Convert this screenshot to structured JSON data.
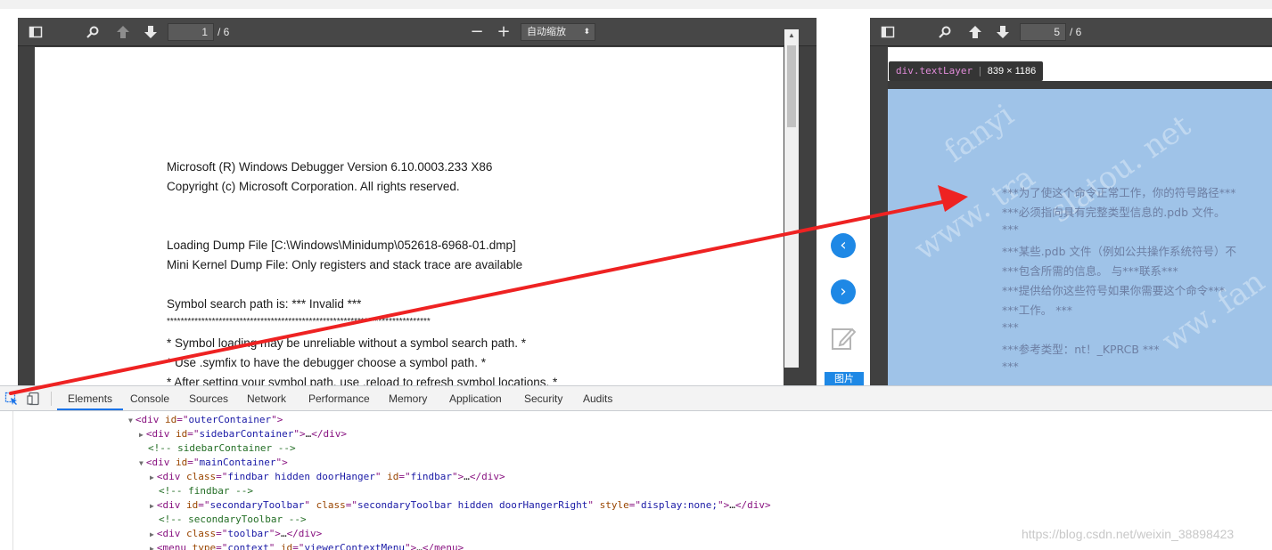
{
  "left_viewer": {
    "toolbar": {
      "sidebar_icon": "sidebar-toggle-icon",
      "search_icon": "search-icon",
      "prev_icon": "arrow-up-icon",
      "next_icon": "arrow-down-icon",
      "page_value": "1",
      "page_total": "/ 6",
      "zoom_out": "−",
      "zoom_in": "+",
      "zoom_select": "自动缩放",
      "zoom_arrow": "⬍"
    },
    "lines": [
      "Microsoft (R) Windows Debugger Version 6.10.0003.233 X86",
      "Copyright (c) Microsoft Corporation. All rights reserved.",
      "Loading Dump File [C:\\Windows\\Minidump\\052618-6968-01.dmp]",
      "Mini Kernel Dump File: Only registers and stack trace are available",
      "Symbol search path is: *** Invalid ***",
      "****************************************************************************",
      "* Symbol loading may be unreliable without a symbol search path.                  *",
      "* Use .symfix to have the debugger choose a symbol path.                          *",
      "* After setting your symbol path, use .reload to refresh symbol locations. *"
    ]
  },
  "mid_controls": {
    "prev_label": "‹",
    "next_label": "›",
    "tag_label": "图片"
  },
  "right_viewer": {
    "toolbar": {
      "page_value": "5",
      "page_total": "/ 6"
    },
    "tooltip": {
      "selector": "div.textLayer",
      "dims": "839 × 1186"
    },
    "lines": [
      "***为了使这个命令正常工作，你的符号路径***",
      "***必须指向具有完整类型信息的.pdb 文件。",
      "***",
      "***某些.pdb 文件（例如公共操作系统符号）不",
      "***包含所需的信息。 与***联系***",
      "***提供给你这些符号如果你需要这个命令***",
      "***工作。   ***",
      "***",
      "***参考类型：nt！_KPRCB ***",
      "***"
    ],
    "watermark": [
      "fanyi",
      "www. tra",
      "slatou. net",
      "ww. fan"
    ]
  },
  "devtools": {
    "tabs": [
      "Elements",
      "Console",
      "Sources",
      "Network",
      "Performance",
      "Memory",
      "Application",
      "Security",
      "Audits"
    ],
    "active_tab": "Elements",
    "dom": [
      {
        "indent": 144,
        "tri": "▼",
        "parts": [
          [
            "tag",
            "<div "
          ],
          [
            "attr",
            "id"
          ],
          [
            "tag",
            "=\""
          ],
          [
            "val",
            "outerContainer"
          ],
          [
            "tag",
            "\">"
          ]
        ]
      },
      {
        "indent": 156,
        "tri": "▶",
        "parts": [
          [
            "tag",
            "<div "
          ],
          [
            "attr",
            "id"
          ],
          [
            "tag",
            "=\""
          ],
          [
            "val",
            "sidebarContainer"
          ],
          [
            "tag",
            "\">"
          ],
          [
            "text",
            "…"
          ],
          [
            "tag",
            "</div>"
          ]
        ]
      },
      {
        "indent": 166,
        "tri": "",
        "parts": [
          [
            "comment",
            "<!-- sidebarContainer -->"
          ]
        ]
      },
      {
        "indent": 156,
        "tri": "▼",
        "parts": [
          [
            "tag",
            "<div "
          ],
          [
            "attr",
            "id"
          ],
          [
            "tag",
            "=\""
          ],
          [
            "val",
            "mainContainer"
          ],
          [
            "tag",
            "\">"
          ]
        ]
      },
      {
        "indent": 168,
        "tri": "▶",
        "parts": [
          [
            "tag",
            "<div "
          ],
          [
            "attr",
            "class"
          ],
          [
            "tag",
            "=\""
          ],
          [
            "val",
            "findbar hidden doorHanger"
          ],
          [
            "tag",
            "\" "
          ],
          [
            "attr",
            "id"
          ],
          [
            "tag",
            "=\""
          ],
          [
            "val",
            "findbar"
          ],
          [
            "tag",
            "\">"
          ],
          [
            "text",
            "…"
          ],
          [
            "tag",
            "</div>"
          ]
        ]
      },
      {
        "indent": 178,
        "tri": "",
        "parts": [
          [
            "comment",
            "<!-- findbar -->"
          ]
        ]
      },
      {
        "indent": 168,
        "tri": "▶",
        "parts": [
          [
            "tag",
            "<div "
          ],
          [
            "attr",
            "id"
          ],
          [
            "tag",
            "=\""
          ],
          [
            "val",
            "secondaryToolbar"
          ],
          [
            "tag",
            "\" "
          ],
          [
            "attr",
            "class"
          ],
          [
            "tag",
            "=\""
          ],
          [
            "val",
            "secondaryToolbar hidden doorHangerRight"
          ],
          [
            "tag",
            "\" "
          ],
          [
            "attr",
            "style"
          ],
          [
            "tag",
            "=\""
          ],
          [
            "val",
            "display:none;"
          ],
          [
            "tag",
            "\">"
          ],
          [
            "text",
            "…"
          ],
          [
            "tag",
            "</div>"
          ]
        ]
      },
      {
        "indent": 178,
        "tri": "",
        "parts": [
          [
            "comment",
            "<!-- secondaryToolbar -->"
          ]
        ]
      },
      {
        "indent": 168,
        "tri": "▶",
        "parts": [
          [
            "tag",
            "<div "
          ],
          [
            "attr",
            "class"
          ],
          [
            "tag",
            "=\""
          ],
          [
            "val",
            "toolbar"
          ],
          [
            "tag",
            "\">"
          ],
          [
            "text",
            "…"
          ],
          [
            "tag",
            "</div>"
          ]
        ]
      },
      {
        "indent": 168,
        "tri": "▶",
        "parts": [
          [
            "tag",
            "<menu "
          ],
          [
            "attr",
            "type"
          ],
          [
            "tag",
            "=\""
          ],
          [
            "val",
            "context"
          ],
          [
            "tag",
            "\" "
          ],
          [
            "attr",
            "id"
          ],
          [
            "tag",
            "=\""
          ],
          [
            "val",
            "viewerContextMenu"
          ],
          [
            "tag",
            "\">"
          ],
          [
            "text",
            "…"
          ],
          [
            "tag",
            "</menu>"
          ]
        ]
      }
    ],
    "footer_watermark": "https://blog.csdn.net/weixin_38898423"
  },
  "colors": {
    "accent": "#1e88e5",
    "arrow": "#ee2222",
    "text_layer": "#9fc3e8"
  }
}
